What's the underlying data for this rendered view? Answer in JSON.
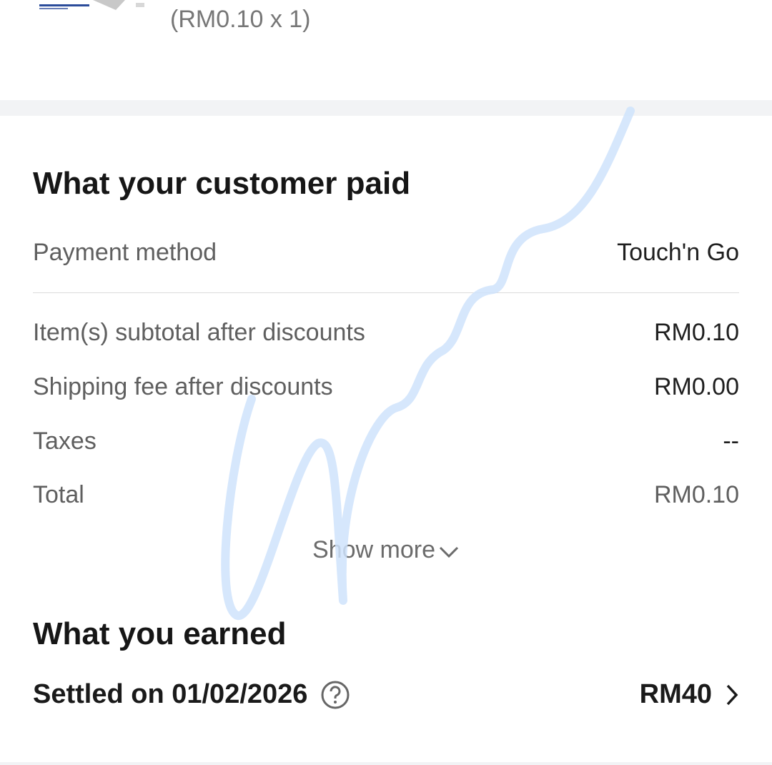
{
  "product": {
    "quantity_text": "(RM0.10 x 1)"
  },
  "customer_paid": {
    "title": "What your customer paid",
    "payment_method": {
      "label": "Payment method",
      "value": "Touch'n Go"
    },
    "rows": [
      {
        "label": "Item(s) subtotal after discounts",
        "value": "RM0.10"
      },
      {
        "label": "Shipping fee after discounts",
        "value": "RM0.00"
      },
      {
        "label": "Taxes",
        "value": "--"
      },
      {
        "label": "Total",
        "value": "RM0.10"
      }
    ],
    "show_more": "Show more"
  },
  "earned": {
    "title": "What you earned",
    "settled_label": "Settled on 01/02/2026",
    "amount": "RM40"
  },
  "icons": {
    "help": "question-circle-icon",
    "expand": "chevron-down-icon",
    "navigate": "chevron-right-icon"
  },
  "colors": {
    "text": "#1a1a1a",
    "muted": "#5f5f5f",
    "divider": "#f2f3f5",
    "signature": "#cfe3fb"
  }
}
